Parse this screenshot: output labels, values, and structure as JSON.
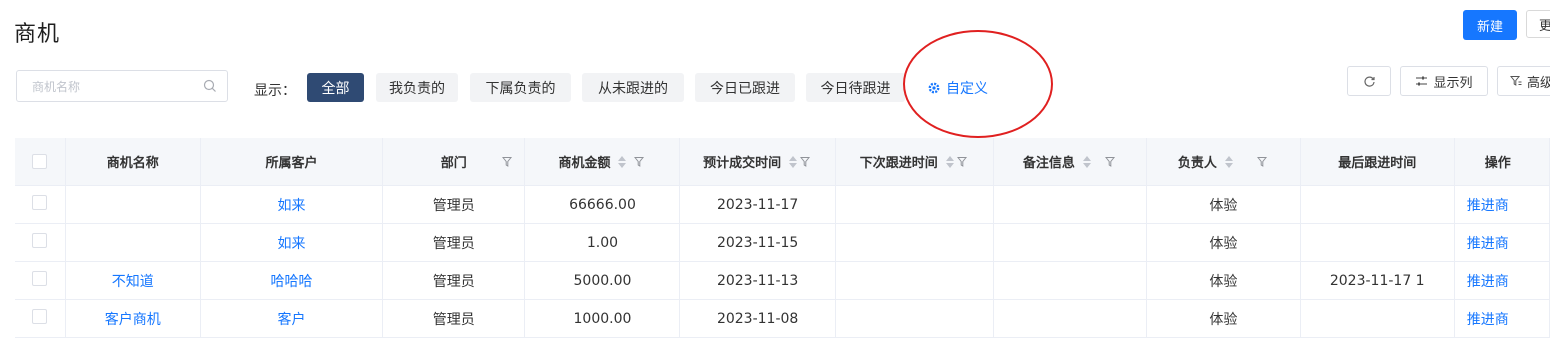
{
  "page": {
    "title": "商机"
  },
  "header": {
    "new_button": "新建",
    "more_button": "更"
  },
  "search": {
    "placeholder": "商机名称"
  },
  "filter": {
    "label": "显示：",
    "chips": [
      "全部",
      "我负责的",
      "下属负责的",
      "从未跟进的",
      "今日已跟进",
      "今日待跟进"
    ],
    "active_index": 0,
    "custom": "自定义"
  },
  "toolbar": {
    "refresh": "",
    "columns": "显示列",
    "advanced": "高级"
  },
  "table": {
    "columns": [
      "商机名称",
      "所属客户",
      "部门",
      "商机金额",
      "预计成交时间",
      "下次跟进时间",
      "备注信息",
      "负责人",
      "最后跟进时间",
      "操作"
    ],
    "rows": [
      {
        "name": "",
        "customer": "如来",
        "dept": "管理员",
        "amount": "66666.00",
        "expected": "2023-11-17",
        "next": "",
        "note": "",
        "owner": "体验",
        "last": "",
        "action": "推进商"
      },
      {
        "name": "",
        "customer": "如来",
        "dept": "管理员",
        "amount": "1.00",
        "expected": "2023-11-15",
        "next": "",
        "note": "",
        "owner": "体验",
        "last": "",
        "action": "推进商"
      },
      {
        "name": "不知道",
        "customer": "哈哈哈",
        "dept": "管理员",
        "amount": "5000.00",
        "expected": "2023-11-13",
        "next": "",
        "note": "",
        "owner": "体验",
        "last": "2023-11-17 1",
        "action": "推进商"
      },
      {
        "name": "客户商机",
        "customer": "客户",
        "dept": "管理员",
        "amount": "1000.00",
        "expected": "2023-11-08",
        "next": "",
        "note": "",
        "owner": "体验",
        "last": "",
        "action": "推进商"
      }
    ]
  },
  "colors": {
    "primary": "#1677ff",
    "active_chip": "#2f4a73",
    "annotation": "#e02020"
  }
}
